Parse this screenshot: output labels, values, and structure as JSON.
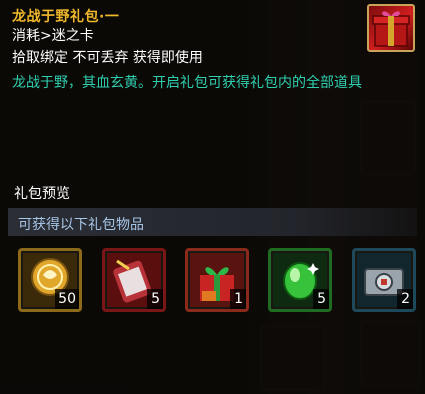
{
  "item": {
    "title": "龙战于野礼包·一",
    "category": "消耗>迷之卡",
    "binding": "拾取绑定 不可丢弃 获得即使用",
    "description": "龙战于野，其血玄黄。开启礼包可获得礼包内的全部道具"
  },
  "preview": {
    "label": "礼包预览",
    "subtitle": "可获得以下礼包物品",
    "items": [
      {
        "icon": "gold-coin-icon",
        "count": "50"
      },
      {
        "icon": "red-scroll-icon",
        "count": "5"
      },
      {
        "icon": "present-box-icon",
        "count": "1"
      },
      {
        "icon": "green-gem-icon",
        "count": "5"
      },
      {
        "icon": "silver-chest-icon",
        "count": "2"
      }
    ]
  }
}
